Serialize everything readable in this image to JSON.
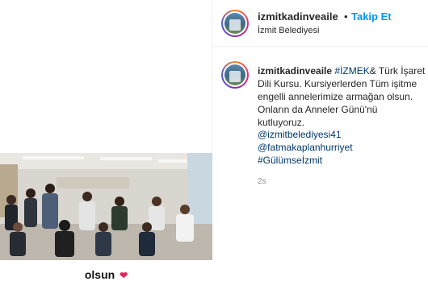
{
  "header": {
    "username": "izmitkadinveaile",
    "separator": "•",
    "follow_label": "Takip Et",
    "location": "İzmit Belediyesi"
  },
  "caption": {
    "username": "izmitkadinveaile",
    "hashtag": "#İZMEK",
    "text": "& Türk İşaret Dili Kursu. Kursiyerlerden Tüm işitme engelli annelerimize armağan olsun. Onların da Anneler Günü'nü kutluyoruz.",
    "links": [
      "@izmitbelediyesi41",
      "@fatmakaplanhurriyet",
      "#Gülümseİzmit"
    ],
    "time": "2s"
  },
  "video": {
    "overlay_text": "olsun",
    "overlay_emoji": "❤"
  },
  "colors": {
    "link": "#00376b",
    "follow": "#0095f6"
  }
}
